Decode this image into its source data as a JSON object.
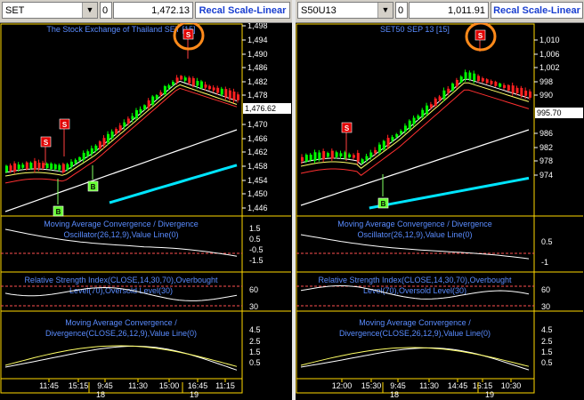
{
  "left": {
    "symbol": "SET",
    "zero": "0",
    "last_price": "1,472.13",
    "recal_label": "Recal Scale-Linear",
    "chart_title": "The Stock Exchange of Thailand SET  [15]",
    "price_axis": [
      "1,498",
      "1,494",
      "1,490",
      "1,486",
      "1,482",
      "1,478",
      "1,470",
      "1,466",
      "1,462",
      "1,458",
      "1,454",
      "1,450",
      "1,446"
    ],
    "last_tag": "1,476.62",
    "macd_title_1": "Moving Average Convergence / Divergence",
    "macd_title_2": "Oscillator(26,12,9),Value Line(0)",
    "macd_axis": [
      "1.5",
      "0.5",
      "-0.5",
      "-1.5"
    ],
    "rsi_title_1": "Relative Strength Index(CLOSE,14,30,70),Overbought",
    "rsi_title_2": "Level(70),Oversold Level(30)",
    "rsi_axis": [
      "60",
      "30"
    ],
    "macd2_title_1": "Moving Average Convergence /",
    "macd2_title_2": "Divergence(CLOSE,26,12,9),Value Line(0)",
    "macd2_axis": [
      "4.5",
      "2.5",
      "1.5",
      "0.5"
    ],
    "time_labels": [
      "11:45",
      "15:15",
      "9:45",
      "11:30",
      "15:00",
      "16:45",
      "11:15"
    ],
    "day_labels": [
      "18",
      "19"
    ],
    "signals": [
      {
        "label": "S"
      },
      {
        "label": "S"
      },
      {
        "label": "S"
      },
      {
        "label": "B"
      },
      {
        "label": "B"
      }
    ]
  },
  "right": {
    "symbol": "S50U13",
    "zero": "0",
    "last_price": "1,011.91",
    "recal_label": "Recal Scale-Linear",
    "chart_title": "SET50 SEP 13  [15]",
    "price_axis": [
      "1,010",
      "1,006",
      "1,002",
      "998",
      "990",
      "986",
      "982",
      "978",
      "974"
    ],
    "last_tag": "995.70",
    "macd_title_1": "Moving Average Convergence / Divergence",
    "macd_title_2": "Oscillator(26,12,9),Value Line(0)",
    "macd_axis": [
      "0.5",
      "-1"
    ],
    "rsi_title_1": "Relative Strength Index(CLOSE,14,30,70),Overbought",
    "rsi_title_2": "Level(70),Oversold Level(30)",
    "rsi_axis": [
      "60",
      "30"
    ],
    "macd2_title_1": "Moving Average Convergence /",
    "macd2_title_2": "Divergence(CLOSE,26,12,9),Value Line(0)",
    "macd2_axis": [
      "4.5",
      "2.5",
      "1.5",
      "0.5"
    ],
    "time_labels": [
      "12:00",
      "15:30",
      "9:45",
      "11:30",
      "14:45",
      "16:15",
      "10:30"
    ],
    "day_labels": [
      "18",
      "19"
    ],
    "signals": [
      {
        "label": "S"
      },
      {
        "label": "S"
      },
      {
        "label": "B"
      }
    ]
  },
  "colors": {
    "up_candle": "#00ff00",
    "down_candle": "#ff2020",
    "signal_sell": "#e00000",
    "signal_buy": "#66ff33",
    "ma_fast": "#ffffff",
    "ma_mid": "#ffff66",
    "ma_slow": "#ff3030",
    "ma_long": "#ffffff",
    "trend_cyan": "#00e5ff",
    "title_blue": "#5a8cff",
    "macd_line": "#ffffff",
    "level_line": "#ff5050",
    "highlight_circle": "#ff8a1a"
  }
}
